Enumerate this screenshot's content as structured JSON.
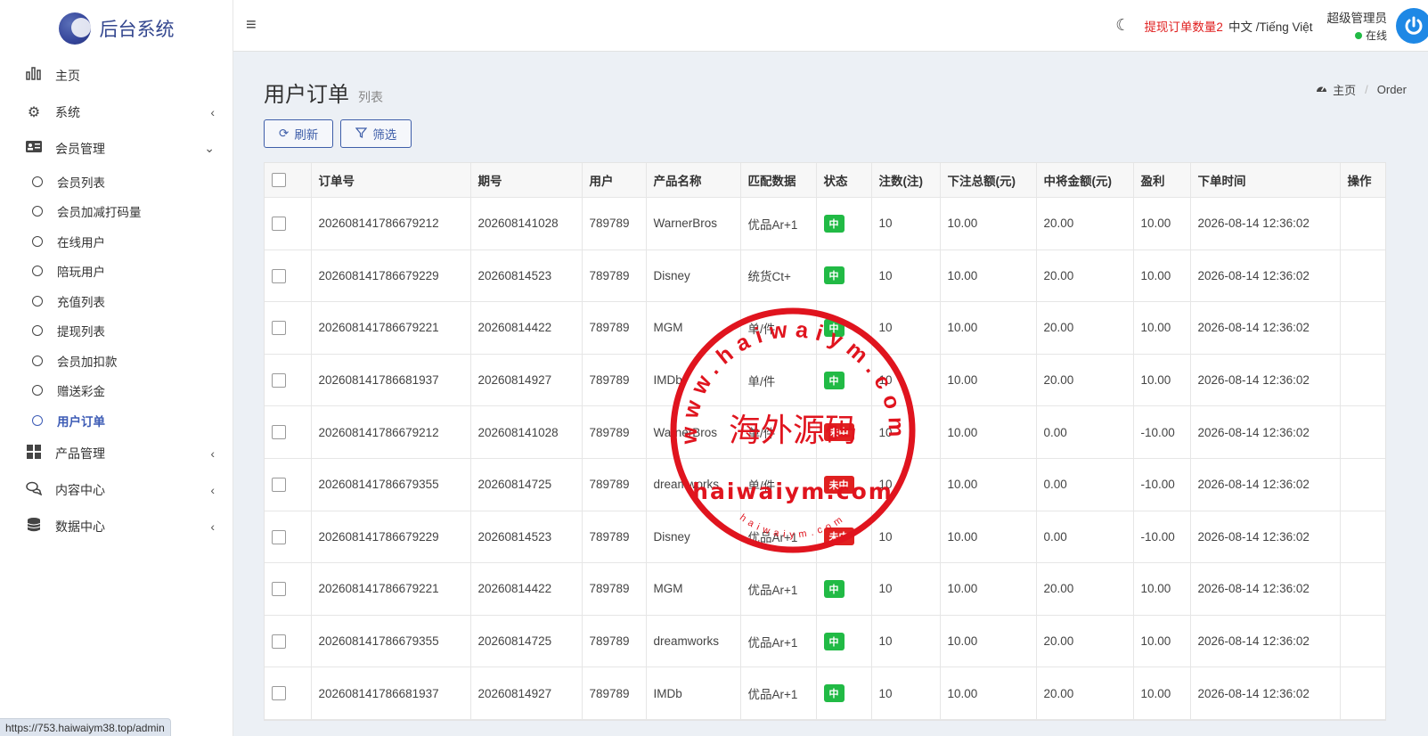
{
  "app": {
    "name": "后台系统"
  },
  "sidebar": {
    "items": [
      {
        "label": "主页",
        "icon": "bar-chart-icon"
      },
      {
        "label": "系统",
        "icon": "gear-icon",
        "arrow": "‹"
      },
      {
        "label": "会员管理",
        "icon": "id-card-icon",
        "arrow": "⌄"
      },
      {
        "label": "产品管理",
        "icon": "grid-icon",
        "arrow": "‹"
      },
      {
        "label": "内容中心",
        "icon": "chat-icon",
        "arrow": "‹"
      },
      {
        "label": "数据中心",
        "icon": "database-icon",
        "arrow": "‹"
      }
    ],
    "member_sub": [
      "会员列表",
      "会员加减打码量",
      "在线用户",
      "陪玩用户",
      "充值列表",
      "提现列表",
      "会员加扣款",
      "赠送彩金",
      "用户订单"
    ]
  },
  "status_url": "https://753.haiwaiym38.top/admin",
  "header": {
    "withdraw_notice": "提现订单数量2",
    "language": "中文 /Tiếng Việt",
    "user_name": "超级管理员",
    "user_status": "在线"
  },
  "page": {
    "title": "用户订单",
    "subtitle": "列表",
    "breadcrumb_home": "主页",
    "breadcrumb_current": "Order",
    "refresh_label": "刷新",
    "filter_label": "筛选"
  },
  "table": {
    "headers": [
      "订单号",
      "期号",
      "用户",
      "产品名称",
      "匹配数据",
      "状态",
      "注数(注)",
      "下注总额(元)",
      "中将金额(元)",
      "盈利",
      "下单时间",
      "操作"
    ],
    "rows": [
      [
        "202608141786679212",
        "202608141028",
        "789789",
        "WarnerBros",
        "优品Ar+1",
        "中",
        "10",
        "10.00",
        "20.00",
        "10.00",
        "2026-08-14 12:36:02"
      ],
      [
        "202608141786679229",
        "20260814523",
        "789789",
        "Disney",
        "统货Ct+",
        "中",
        "10",
        "10.00",
        "20.00",
        "10.00",
        "2026-08-14 12:36:02"
      ],
      [
        "202608141786679221",
        "20260814422",
        "789789",
        "MGM",
        "单/件",
        "中",
        "10",
        "10.00",
        "20.00",
        "10.00",
        "2026-08-14 12:36:02"
      ],
      [
        "202608141786681937",
        "20260814927",
        "789789",
        "IMDb",
        "单/件",
        "中",
        "10",
        "10.00",
        "20.00",
        "10.00",
        "2026-08-14 12:36:02"
      ],
      [
        "202608141786679212",
        "202608141028",
        "789789",
        "WarnerBros",
        "单/件",
        "未中",
        "10",
        "10.00",
        "0.00",
        "-10.00",
        "2026-08-14 12:36:02"
      ],
      [
        "202608141786679355",
        "20260814725",
        "789789",
        "dreamworks",
        "单/件",
        "未中",
        "10",
        "10.00",
        "0.00",
        "-10.00",
        "2026-08-14 12:36:02"
      ],
      [
        "202608141786679229",
        "20260814523",
        "789789",
        "Disney",
        "优品Ar+1",
        "未中",
        "10",
        "10.00",
        "0.00",
        "-10.00",
        "2026-08-14 12:36:02"
      ],
      [
        "202608141786679221",
        "20260814422",
        "789789",
        "MGM",
        "优品Ar+1",
        "中",
        "10",
        "10.00",
        "20.00",
        "10.00",
        "2026-08-14 12:36:02"
      ],
      [
        "202608141786679355",
        "20260814725",
        "789789",
        "dreamworks",
        "优品Ar+1",
        "中",
        "10",
        "10.00",
        "20.00",
        "10.00",
        "2026-08-14 12:36:02"
      ],
      [
        "202608141786681937",
        "20260814927",
        "789789",
        "IMDb",
        "优品Ar+1",
        "中",
        "10",
        "10.00",
        "20.00",
        "10.00",
        "2026-08-14 12:36:02"
      ]
    ]
  },
  "watermark": {
    "center_text": "海外源码",
    "lower_text": "haiwaiym.com",
    "ring_text": "www.haiwaiym.com",
    "small_text": "haiwaiym.com",
    "color": "#e0141e"
  },
  "colors": {
    "brand": "#34478f",
    "accent": "#3e5ea9",
    "win": "#21ba45",
    "lose": "#e02020"
  }
}
